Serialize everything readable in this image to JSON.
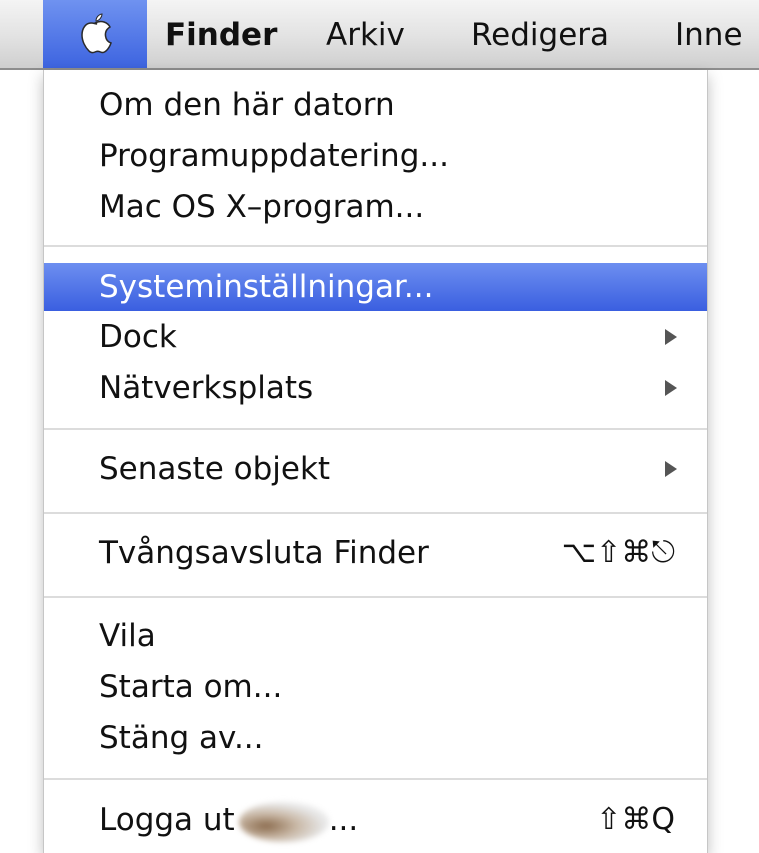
{
  "menubar": {
    "apple_icon": "apple-logo-icon",
    "titles": [
      "Finder",
      "Arkiv",
      "Redigera",
      "Inne"
    ]
  },
  "apple_menu": {
    "items": [
      {
        "label": "Om den här datorn"
      },
      {
        "label": "Programuppdatering..."
      },
      {
        "label": "Mac OS X–program..."
      },
      {
        "label": "Systeminställningar...",
        "highlighted": true
      },
      {
        "label": "Dock",
        "submenu": true
      },
      {
        "label": "Nätverksplats",
        "submenu": true
      },
      {
        "label": "Senaste objekt",
        "submenu": true
      },
      {
        "label": "Tvångsavsluta Finder",
        "shortcut": "⌥⇧⌘⎋"
      },
      {
        "label": "Vila"
      },
      {
        "label": "Starta om..."
      },
      {
        "label": "Stäng av..."
      },
      {
        "label_prefix": "Logga ut",
        "label_suffix": "...",
        "shortcut": "⇧⌘Q",
        "redacted_username": true
      }
    ]
  },
  "colors": {
    "highlight": "#3a5fe0",
    "menubar": "#e2e2e2"
  }
}
